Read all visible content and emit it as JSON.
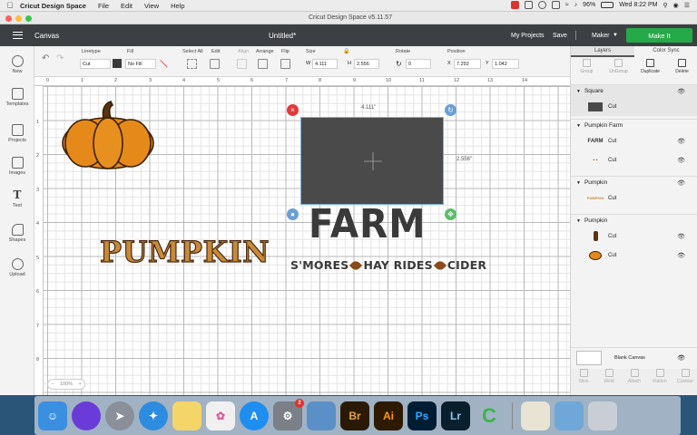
{
  "menubar": {
    "app_name": "Cricut Design Space",
    "items": [
      "File",
      "Edit",
      "View",
      "Help"
    ],
    "window_title": "Cricut Design Space  v5.11.57",
    "battery": "96%",
    "clock": "Wed 8:22 PM"
  },
  "header": {
    "section": "Canvas",
    "doc_title": "Untitled*",
    "my_projects": "My Projects",
    "save": "Save",
    "machine": "Maker",
    "make_it": "Make It"
  },
  "toolbar": {
    "linetype_label": "Linetype",
    "linetype_value": "Cut",
    "fill_label": "Fill",
    "fill_value": "No Fill",
    "select_all": "Select All",
    "edit": "Edit",
    "align": "Align",
    "arrange": "Arrange",
    "flip": "Flip",
    "size_label": "Size",
    "w_label": "W",
    "w_value": "4.111",
    "h_label": "H",
    "h_value": "2.556",
    "rotate_label": "Rotate",
    "rotate_value": "0",
    "position_label": "Position",
    "x_label": "X",
    "x_value": "7.292",
    "y_label": "Y",
    "y_value": "1.042"
  },
  "leftbar": [
    {
      "label": "New",
      "icon": "plus-circle-icon"
    },
    {
      "label": "Templates",
      "icon": "shirt-icon"
    },
    {
      "label": "Projects",
      "icon": "projects-icon"
    },
    {
      "label": "Images",
      "icon": "image-icon"
    },
    {
      "label": "Text",
      "icon": "text-icon"
    },
    {
      "label": "Shapes",
      "icon": "shapes-icon"
    },
    {
      "label": "Upload",
      "icon": "upload-icon"
    }
  ],
  "canvas": {
    "ruler_top": [
      "0",
      "1",
      "2",
      "3",
      "4",
      "5",
      "6",
      "7",
      "8",
      "9",
      "10",
      "11",
      "12",
      "13",
      "14"
    ],
    "ruler_left": [
      "1",
      "2",
      "3",
      "4",
      "5",
      "6",
      "7",
      "8"
    ],
    "zoom": "100%",
    "dim_width": "4.111\"",
    "dim_height": "2.556\"",
    "farm_text": "FARM",
    "smores_1": "S'MORES",
    "smores_2": "HAY RIDES",
    "smores_3": "CIDER",
    "pumpkin_text": "PUMPKIN",
    "colors": {
      "pumpkin": "#e58a1a",
      "stem": "#5a3410",
      "square": "#4a4a4a",
      "pumpkin_text": "#c88a3a"
    }
  },
  "layers_panel": {
    "tabs": [
      "Layers",
      "Color Sync"
    ],
    "tools": [
      {
        "label": "Group",
        "enabled": false
      },
      {
        "label": "UnGroup",
        "enabled": false
      },
      {
        "label": "Duplicate",
        "enabled": true
      },
      {
        "label": "Delete",
        "enabled": true
      }
    ],
    "groups": [
      {
        "title": "Square",
        "rows": [
          {
            "label": "Cut",
            "thumb": "square"
          }
        ]
      },
      {
        "title": "Pumpkin Farm",
        "rows": [
          {
            "label": "Cut",
            "thumb": "farm"
          },
          {
            "label": "Cut",
            "thumb": "leaves"
          }
        ]
      },
      {
        "title": "Pumpkin",
        "rows": [
          {
            "label": "Cut",
            "thumb": "pumpkin-text"
          }
        ]
      },
      {
        "title": "Pumpkin",
        "rows": [
          {
            "label": "Cut",
            "thumb": "stem"
          },
          {
            "label": "Cut",
            "thumb": "pumpkin"
          }
        ]
      }
    ],
    "blank_canvas": "Blank Canvas",
    "bottom_tools": [
      "Slice",
      "Weld",
      "Attach",
      "Flatten",
      "Contour"
    ]
  },
  "dock": [
    {
      "name": "finder",
      "color": "#3b8fe0"
    },
    {
      "name": "siri",
      "color": "#6a3bd8"
    },
    {
      "name": "launchpad",
      "color": "#8a8f99"
    },
    {
      "name": "safari",
      "color": "#2e8ce0"
    },
    {
      "name": "notes",
      "color": "#f4d56a"
    },
    {
      "name": "photos",
      "color": "#f0f0f0"
    },
    {
      "name": "app-store",
      "color": "#1f8ef1"
    },
    {
      "name": "system-preferences",
      "color": "#7a7f88",
      "badge": "2"
    },
    {
      "name": "preview",
      "color": "#5a8fc8"
    },
    {
      "name": "bridge",
      "label": "Br",
      "color": "#2a1a05"
    },
    {
      "name": "illustrator",
      "label": "Ai",
      "color": "#2e1a00"
    },
    {
      "name": "photoshop",
      "label": "Ps",
      "color": "#001d34"
    },
    {
      "name": "lightroom",
      "label": "Lr",
      "color": "#0a1f2e"
    },
    {
      "name": "cricut",
      "color": "#3bb34a"
    },
    {
      "name": "textedit",
      "color": "#e8e3d2"
    },
    {
      "name": "folder",
      "color": "#6fa8d8"
    },
    {
      "name": "trash",
      "color": "#c9ced6"
    }
  ]
}
